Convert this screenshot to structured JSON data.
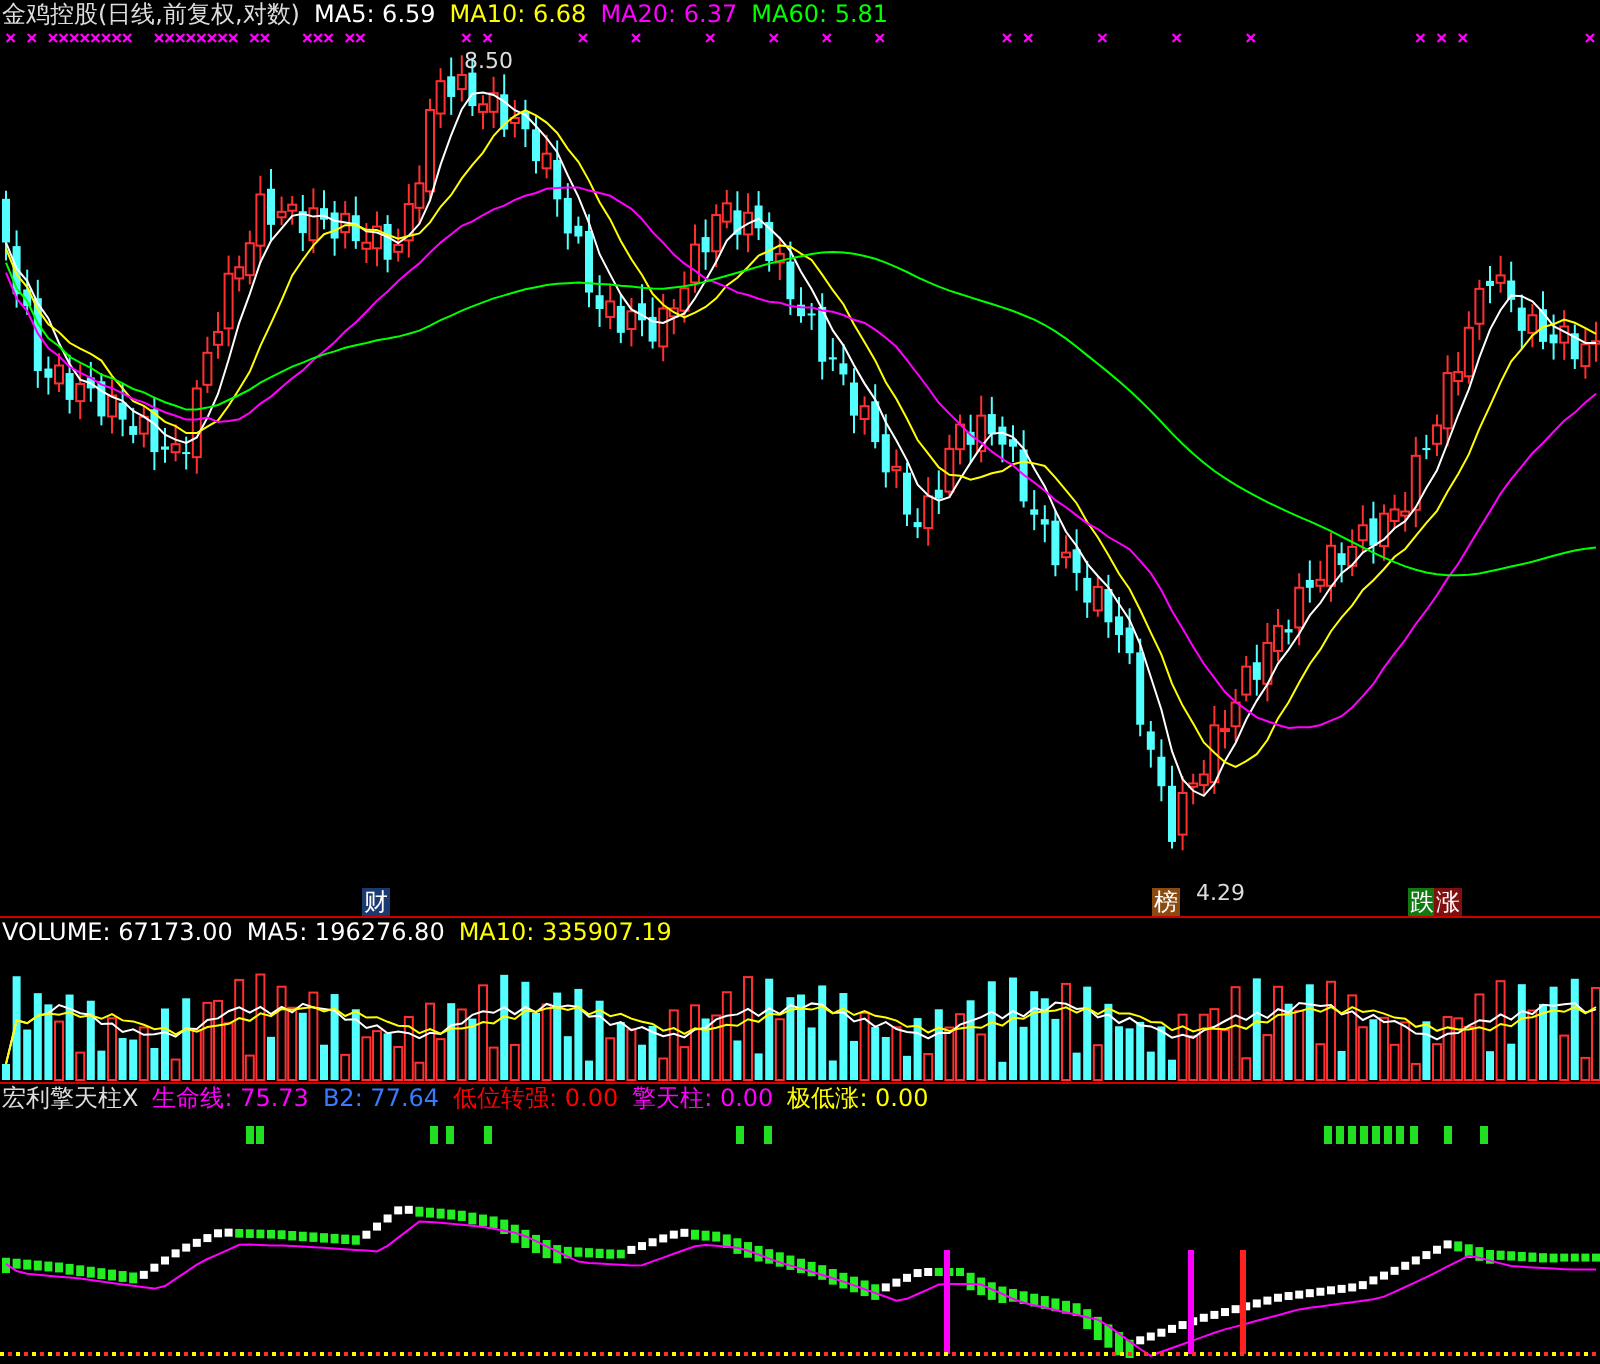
{
  "main_header": {
    "title": "金鸡控股(日线,前复权,对数)",
    "indicators": [
      {
        "label": "MA5: 6.59",
        "color": "#ffffff"
      },
      {
        "label": "MA10: 6.68",
        "color": "#ffff00"
      },
      {
        "label": "MA20: 6.37",
        "color": "#ff00ff"
      },
      {
        "label": "MA60: 5.81",
        "color": "#00ff00"
      }
    ]
  },
  "main_chart": {
    "high_label": "8.50",
    "low_label": "4.29",
    "markers": [
      {
        "text": "财",
        "color": "#1a3a70"
      },
      {
        "text": "榜",
        "color": "#8a4a10"
      },
      {
        "text": "跌",
        "color": "#107a10"
      },
      {
        "text": "涨",
        "color": "#801010"
      }
    ]
  },
  "volume_header": {
    "indicators": [
      {
        "label": "VOLUME: 67173.00",
        "color": "#ffffff"
      },
      {
        "label": "MA5: 196276.80",
        "color": "#ffffff"
      },
      {
        "label": "MA10: 335907.19",
        "color": "#ffff00"
      }
    ]
  },
  "indicator_header": {
    "title": "宏利擎天柱X",
    "indicators": [
      {
        "label": "生命线: 75.73",
        "color": "#ff00ff"
      },
      {
        "label": "B2: 77.64",
        "color": "#3a7aff"
      },
      {
        "label": "低位转强: 0.00",
        "color": "#ff0000"
      },
      {
        "label": "擎天柱: 0.00",
        "color": "#ff00ff"
      },
      {
        "label": "极低涨: 0.00",
        "color": "#ffff00"
      }
    ]
  }
}
